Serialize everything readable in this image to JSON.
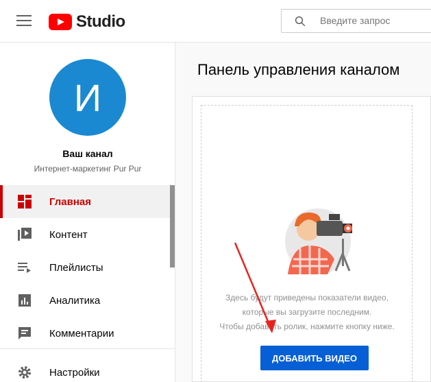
{
  "header": {
    "logo_text": "Studio",
    "search_placeholder": "Введите запрос"
  },
  "sidebar": {
    "avatar_letter": "И",
    "channel_name": "Ваш канал",
    "channel_subtitle": "Интернет-маркетинг Pur Pur",
    "items": [
      {
        "label": "Главная",
        "icon": "dashboard-icon",
        "active": true
      },
      {
        "label": "Контент",
        "icon": "content-icon"
      },
      {
        "label": "Плейлисты",
        "icon": "playlists-icon"
      },
      {
        "label": "Аналитика",
        "icon": "analytics-icon"
      },
      {
        "label": "Комментарии",
        "icon": "comments-icon"
      },
      {
        "label": "Настройки",
        "icon": "settings-icon"
      }
    ]
  },
  "main": {
    "title": "Панель управления каналом",
    "empty_line1": "Здесь будут приведены показатели видео,",
    "empty_line2": "которые вы загрузите последним.",
    "empty_line3": "Чтобы добавить ролик, нажмите кнопку ниже.",
    "add_button": "ДОБАВИТЬ ВИДЕО"
  },
  "colors": {
    "brand_red": "#ff0000",
    "active_red": "#cc0000",
    "button_blue": "#065fd4",
    "avatar_blue": "#1a89d1"
  }
}
